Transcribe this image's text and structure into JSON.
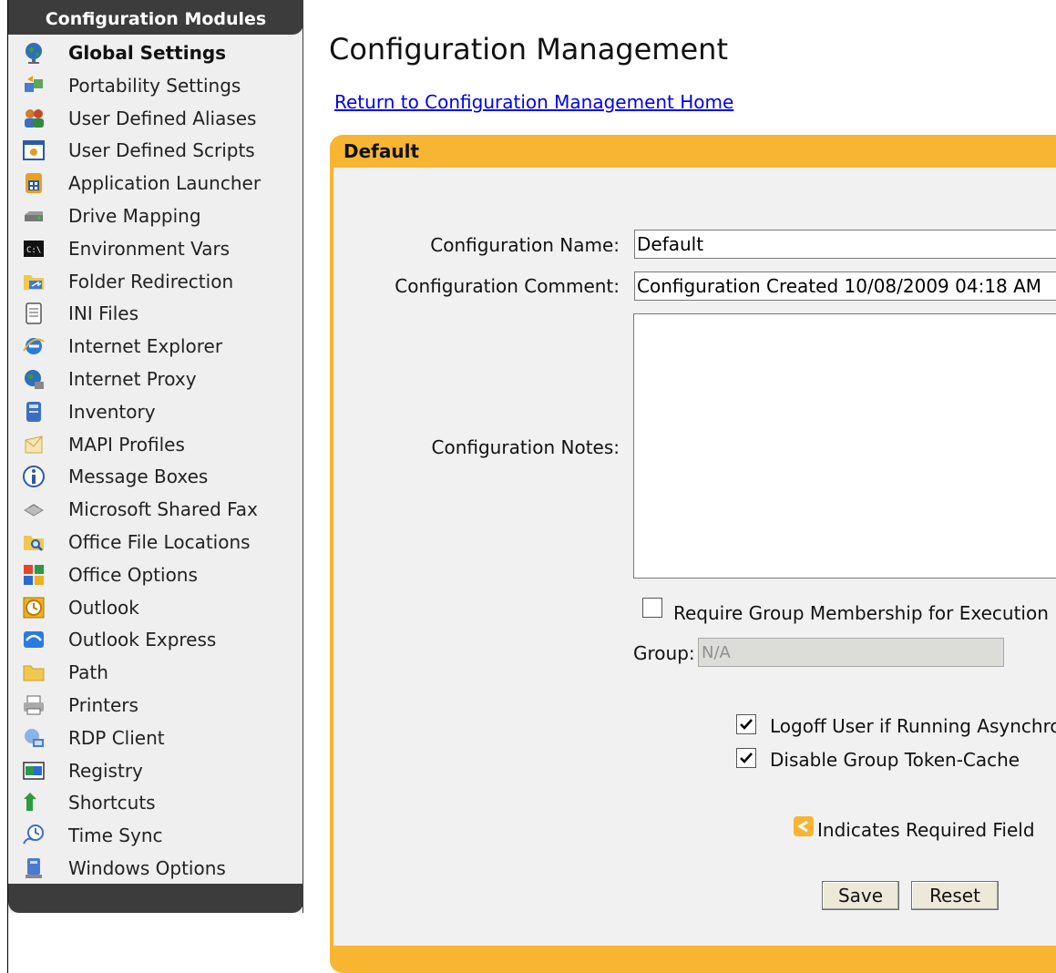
{
  "sidebar": {
    "title": "Configuration Modules",
    "items": [
      {
        "label": "Global Settings",
        "icon": "globe-icon"
      },
      {
        "label": "Portability Settings",
        "icon": "portability-icon"
      },
      {
        "label": "User Defined Aliases",
        "icon": "users-icon"
      },
      {
        "label": "User Defined Scripts",
        "icon": "script-icon"
      },
      {
        "label": "Application Launcher",
        "icon": "app-launcher-icon"
      },
      {
        "label": "Drive Mapping",
        "icon": "drive-icon"
      },
      {
        "label": "Environment Vars",
        "icon": "console-icon"
      },
      {
        "label": "Folder Redirection",
        "icon": "folder-redirect-icon"
      },
      {
        "label": "INI Files",
        "icon": "ini-file-icon"
      },
      {
        "label": "Internet Explorer",
        "icon": "internet-explorer-icon"
      },
      {
        "label": "Internet Proxy",
        "icon": "proxy-globe-icon"
      },
      {
        "label": "Inventory",
        "icon": "inventory-icon"
      },
      {
        "label": "MAPI Profiles",
        "icon": "envelope-icon"
      },
      {
        "label": "Message Boxes",
        "icon": "info-icon"
      },
      {
        "label": "Microsoft Shared Fax",
        "icon": "fax-icon"
      },
      {
        "label": "Office File Locations",
        "icon": "folder-search-icon"
      },
      {
        "label": "Office Options",
        "icon": "office-icon"
      },
      {
        "label": "Outlook",
        "icon": "clock-icon"
      },
      {
        "label": "Outlook Express",
        "icon": "outlook-express-icon"
      },
      {
        "label": "Path",
        "icon": "folder-icon"
      },
      {
        "label": "Printers",
        "icon": "printer-icon"
      },
      {
        "label": "RDP Client",
        "icon": "remote-desktop-icon"
      },
      {
        "label": "Registry",
        "icon": "registry-icon"
      },
      {
        "label": "Shortcuts",
        "icon": "shortcut-arrow-icon"
      },
      {
        "label": "Time Sync",
        "icon": "time-sync-icon"
      },
      {
        "label": "Windows Options",
        "icon": "computer-icon"
      }
    ]
  },
  "main": {
    "title": "Configuration Management",
    "home_link": "Return to Configuration Management Home"
  },
  "panel": {
    "title": "Default",
    "config_name_label": "Configuration Name:",
    "config_name_value": "Default",
    "config_comment_label": "Configuration Comment:",
    "config_comment_value": "Configuration Created 10/08/2009 04:18 AM",
    "config_notes_label": "Configuration Notes:",
    "config_notes_value": "",
    "require_group_label": "Require Group Membership for Execution",
    "require_group_checked": false,
    "group_label": "Group:",
    "group_value": "N/A",
    "logoff_label": "Logoff User if Running Asynchronously",
    "logoff_checked": true,
    "disable_cache_label": "Disable Group Token-Cache",
    "disable_cache_checked": true,
    "required_note": "Indicates Required Field",
    "save_label": "Save",
    "reset_label": "Reset"
  },
  "colors": {
    "accent": "#f7b531",
    "sidebar_dark": "#3c3c3c",
    "link": "#0000ee"
  }
}
